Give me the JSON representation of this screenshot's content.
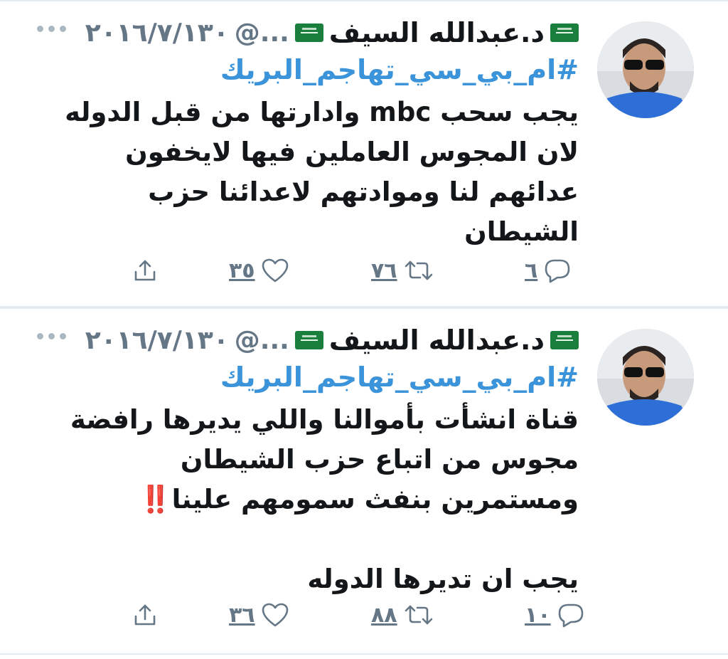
{
  "tweets": [
    {
      "author_name": "د.عبدالله السيف",
      "handle": "...@",
      "date": "٢٠١٦/٧/١٣٠",
      "hashtag": "#ام_بي_سي_تهاجم_البريك",
      "body": "يجب سحب mbc وادارتها من قبل الدوله\nلان المجوس العاملين فيها لايخفون\nعدائهم لنا وموادتهم لاعدائنا حزب\nالشيطان",
      "reply_count": "٦",
      "retweet_count": "٧٦",
      "like_count": "٣٥"
    },
    {
      "author_name": "د.عبدالله السيف",
      "handle": "...@",
      "date": "٢٠١٦/٧/١٣٠",
      "hashtag": "#ام_بي_سي_تهاجم_البريك",
      "body": "قناة انشأت بأموالنا واللي يديرها رافضة\nمجوس من اتباع حزب الشيطان\nومستمرين بنفث سمومهم علينا‼️\n\nيجب ان تديرها الدوله",
      "reply_count": "١٠",
      "retweet_count": "٨٨",
      "like_count": "٣٦"
    }
  ],
  "colors": {
    "link": "#3b94d9",
    "muted": "#657786",
    "divider": "#e6ecf0",
    "flag": "#1a7f3c"
  },
  "icons": [
    "avatar",
    "flag-icon",
    "more-icon",
    "reply-icon",
    "retweet-icon",
    "like-icon",
    "share-icon"
  ]
}
